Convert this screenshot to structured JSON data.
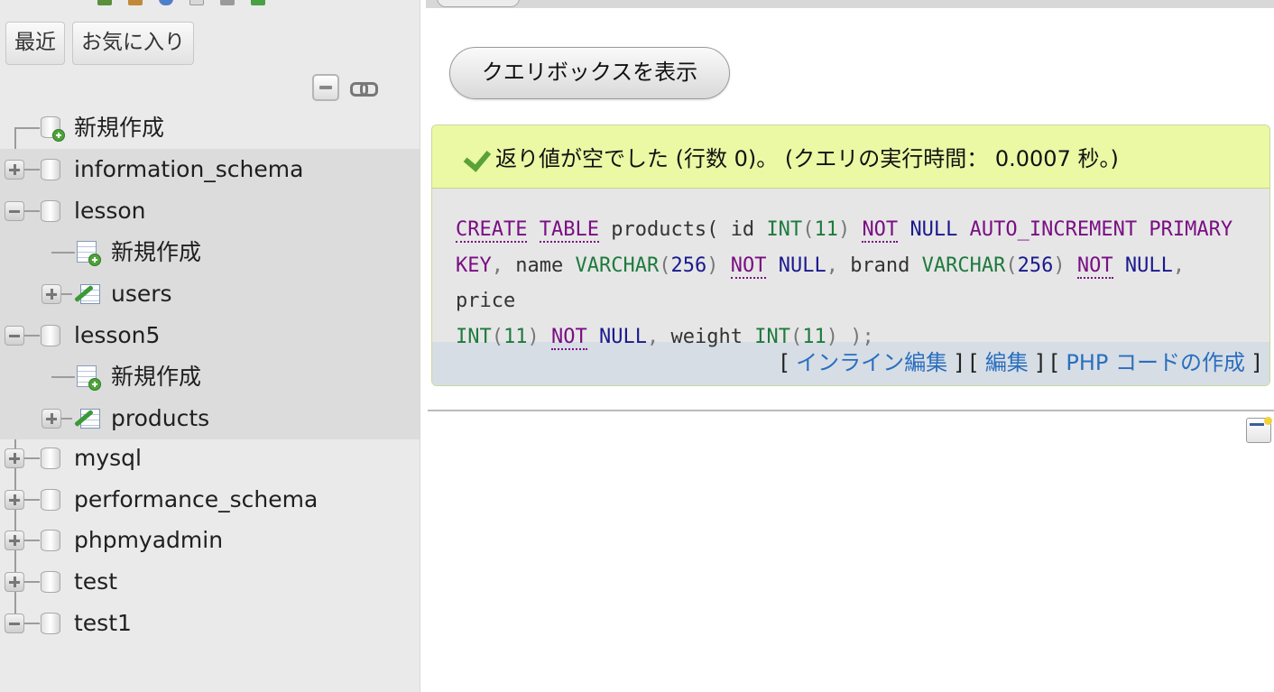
{
  "nav": {
    "tabs": [
      "最近",
      "お気に入り"
    ],
    "tree": [
      {
        "kind": "new",
        "label": "新規作成"
      },
      {
        "kind": "db",
        "label": "information_schema",
        "expanded": false
      },
      {
        "kind": "db",
        "label": "lesson",
        "expanded": true
      },
      {
        "kind": "new-table",
        "label": "新規作成"
      },
      {
        "kind": "table",
        "label": "users"
      },
      {
        "kind": "db",
        "label": "lesson5",
        "expanded": true
      },
      {
        "kind": "new-table",
        "label": "新規作成"
      },
      {
        "kind": "table",
        "label": "products"
      },
      {
        "kind": "db",
        "label": "mysql",
        "expanded": false
      },
      {
        "kind": "db",
        "label": "performance_schema",
        "expanded": false
      },
      {
        "kind": "db",
        "label": "phpmyadmin",
        "expanded": false
      },
      {
        "kind": "db",
        "label": "test",
        "expanded": false
      },
      {
        "kind": "db",
        "label": "test1",
        "expanded": true
      }
    ]
  },
  "main": {
    "show_query_label": "クエリボックスを表示",
    "success_message": "返り値が空でした (行数 0)。 (クエリの実行時間： 0.0007 秒。)",
    "sql": {
      "l1": [
        "CREATE",
        "TABLE",
        "products(",
        "id",
        "INT",
        "(",
        "11",
        ")",
        "NOT",
        "NULL",
        "AUTO_INCREMENT",
        "PRIMARY"
      ],
      "l2": [
        "KEY",
        ",",
        "name",
        "VARCHAR",
        "(",
        "256",
        ")",
        "NOT",
        "NULL",
        ",",
        "brand",
        "VARCHAR",
        "(",
        "256",
        ")",
        "NOT",
        "NULL",
        ",",
        "price"
      ],
      "l3": [
        "INT",
        "(",
        "11",
        ")",
        "NOT",
        "NULL",
        ",",
        "weight",
        "INT",
        "(",
        "11",
        ")",
        ")",
        ";"
      ]
    },
    "actions": {
      "inline_edit": "インライン編集",
      "edit": "編集",
      "php_code": "PHP コードの作成"
    }
  },
  "colors": {
    "nav_bg": "#eaeaea",
    "success_bg": "#ebf8a4",
    "link": "#2a6ebf",
    "keyword": "#7a0e84",
    "type": "#1e7a3e"
  }
}
